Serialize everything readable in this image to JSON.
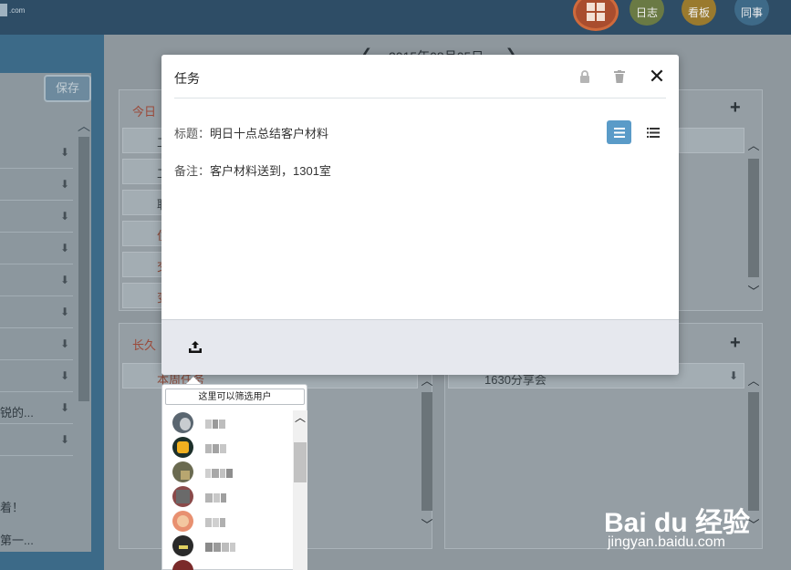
{
  "topbar": {
    "logo_suffix": ".com",
    "buttons": [
      "日志",
      "看板",
      "同事"
    ]
  },
  "left_panel": {
    "save_label": "保存",
    "row_texts": [
      "锐的...",
      "着！",
      "第一..."
    ]
  },
  "background": {
    "date": "2015年08月05日",
    "today_panel_title": "今日",
    "today_rows": [
      "工",
      "工",
      "职",
      "住",
      "交",
      "变"
    ],
    "longterm_panel_title": "长久",
    "longterm_first_row": "本周任务",
    "right_row": "1630分享会"
  },
  "modal": {
    "title": "任务",
    "title_field_label": "标题：",
    "title_field_value": "明日十点总结客户材料",
    "note_field_label": "备注：",
    "note_field_value": "客户材料送到，1301室"
  },
  "user_popup": {
    "filter_placeholder": "这里可以筛选用户",
    "users": [
      {
        "avatar_color": "#5a6670"
      },
      {
        "avatar_color": "#f0b020"
      },
      {
        "avatar_color": "#6a6a50"
      },
      {
        "avatar_color": "#8a4a4a"
      },
      {
        "avatar_color": "#e89070"
      },
      {
        "avatar_color": "#2a2a2a"
      }
    ]
  },
  "watermark": {
    "brand": "Bai du 经验",
    "site": "jingyan.baidu.com"
  },
  "colors": {
    "accent_blue": "#5a9bc8",
    "topbar": "#2e4d66",
    "overlay": "#8e979d"
  }
}
